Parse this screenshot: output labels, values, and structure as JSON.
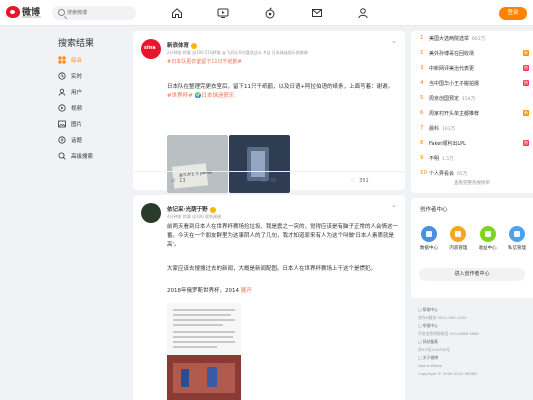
{
  "nav": {
    "logo_text": "微博",
    "logo_sub": "weibo.com",
    "search_placeholder": "搜索微博",
    "login_label": "登录",
    "icons": [
      "home-icon",
      "video-icon",
      "hot-icon",
      "message-icon",
      "profile-icon"
    ]
  },
  "sidebar": {
    "title": "搜索结果",
    "items": [
      {
        "label": "综合",
        "icon": "all-icon",
        "color": "#ff8200"
      },
      {
        "label": "实时",
        "icon": "realtime-icon",
        "color": "#333333"
      },
      {
        "label": "用户",
        "icon": "user-icon",
        "color": "#333333"
      },
      {
        "label": "视频",
        "icon": "video-icon",
        "color": "#333333"
      },
      {
        "label": "图片",
        "icon": "image-icon",
        "color": "#333333"
      },
      {
        "label": "话题",
        "icon": "topic-icon",
        "color": "#333333"
      },
      {
        "label": "高级搜索",
        "icon": "advanced-search-icon",
        "color": "#333333"
      }
    ]
  },
  "posts": [
    {
      "author": "新浪体育",
      "meta": "2分钟前 转载 自100 516转载 @飞羽分开也喜欢这么 #自 日本球迷很乐很感谢",
      "tag": "#日本队更衣室留下11只千纸鹤#",
      "text1": "日本队在整理完更衣室后，留下11只千纸鹤，以及日语+阿拉伯语的纸条，上面写着：谢谢。",
      "topic": "#世界杯# 🌍日本球迷很乐",
      "mat_text": "ありがとう JAPAN",
      "repost_count": "13",
      "comment_count": "85",
      "like_count": "351"
    },
    {
      "author": "依记采·光荫于野",
      "meta": "4分钟前 转载 自100 收到谢谢",
      "text1": "前两天看到日本人在世界杯赛场捡垃圾、我是震之一突的，觉得应该是有脑子正常的人会情这一番。今天在一个朋友群里为这事阴人的了几句，我才知道原来有人为这个叫做'日本人素质就是高'。",
      "text2": "大家应该去搜搜过去的新闻，大概是新闻配图。日本人在世界杯赛场上干这个是惯犯。",
      "text3": "2018年俄罗斯世界杯，2014",
      "more_label": "展开"
    }
  ],
  "hot_list": {
    "items": [
      {
        "rank": "1",
        "title": "美国大选两院选举",
        "count": "663万",
        "badge": ""
      },
      {
        "rank": "2",
        "title": "美外孙博哥在回收场",
        "count": "",
        "badge": "新"
      },
      {
        "rank": "3",
        "title": "中新网评美治代表更",
        "count": "",
        "badge": "热"
      },
      {
        "rank": "4",
        "title": "当中国华小王子搬拍摄",
        "count": "",
        "badge": "热"
      },
      {
        "rank": "5",
        "title": "周京创国预定",
        "count": "154万",
        "badge": ""
      },
      {
        "rank": "6",
        "title": "周家村开头单主都推荐",
        "count": "",
        "badge": "新"
      },
      {
        "rank": "7",
        "title": "晨科",
        "count": "163万",
        "badge": ""
      },
      {
        "rank": "8",
        "title": "Faker顺利出LPL",
        "count": "",
        "badge": "热"
      },
      {
        "rank": "9",
        "title": "不明",
        "count": "1.5万",
        "badge": ""
      },
      {
        "rank": "10",
        "title": "个人弄看会",
        "count": "65万",
        "badge": ""
      }
    ],
    "view_all": "查看完整热搜榜单"
  },
  "creator": {
    "title": "创作者中心",
    "items": [
      {
        "label": "数据中心",
        "color": "#4a90e2"
      },
      {
        "label": "内容管理",
        "color": "#f5a623"
      },
      {
        "label": "收益中心",
        "color": "#7ed321"
      },
      {
        "label": "私信管理",
        "color": "#50a0f0"
      }
    ],
    "enter_label": "进入创作者中心"
  },
  "footer": {
    "rows": [
      "▢ 帮助中心",
      "合作&服务 0022-265-1920",
      "▢ 举报中心",
      "不良信息举报电话 010-6088 3888",
      "▢ 网站备案",
      "京ICP证100780号",
      "▢ 关于微博",
      "About Weibo",
      "Copyright © 2009-2022 WEIBO"
    ]
  }
}
